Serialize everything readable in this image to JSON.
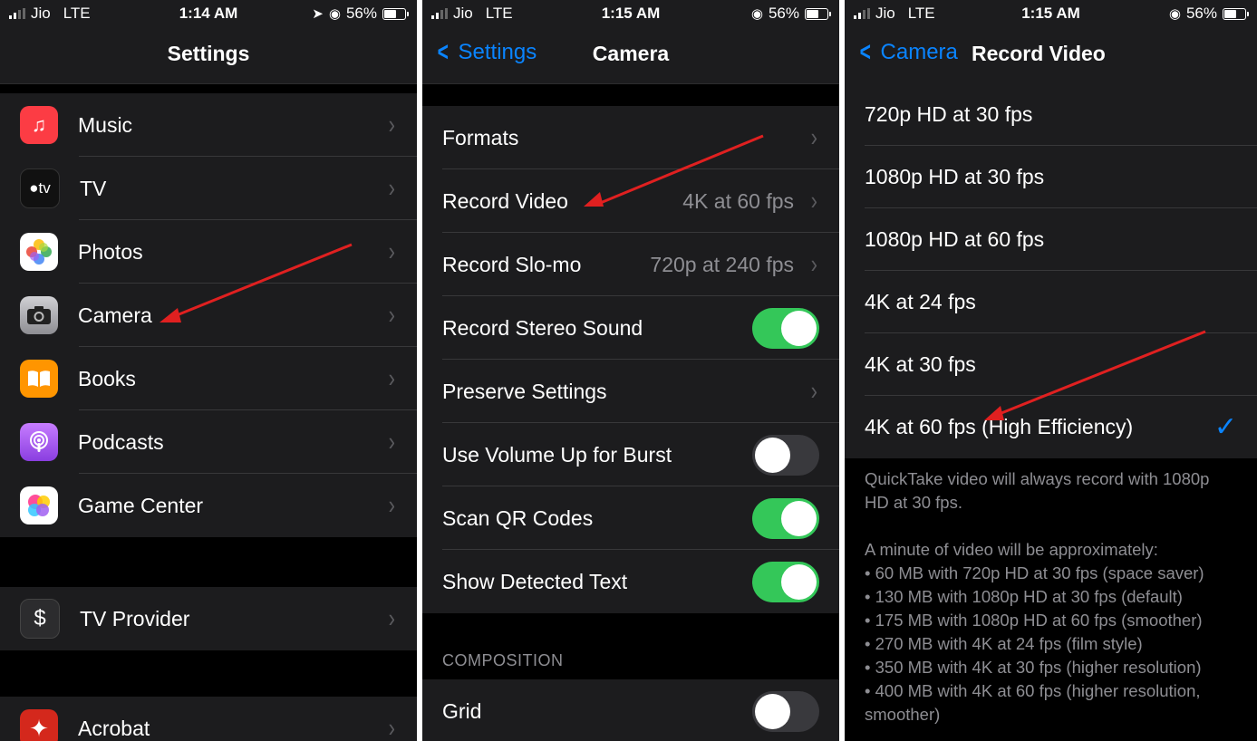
{
  "status_bars": [
    {
      "carrier": "Jio",
      "network": "LTE",
      "time": "1:14 AM",
      "battery": "56%"
    },
    {
      "carrier": "Jio",
      "network": "LTE",
      "time": "1:15 AM",
      "battery": "56%"
    },
    {
      "carrier": "Jio",
      "network": "LTE",
      "time": "1:15 AM",
      "battery": "56%"
    }
  ],
  "battery_level": 0.56,
  "settings": {
    "title": "Settings",
    "items": [
      {
        "label": "Music",
        "icon": "music-icon",
        "color": "#fc3c44"
      },
      {
        "label": "TV",
        "icon": "apple-tv-icon",
        "color": "#1c1c1e"
      },
      {
        "label": "Photos",
        "icon": "photos-icon",
        "color": "#ffffff"
      },
      {
        "label": "Camera",
        "icon": "camera-icon",
        "color": "#8e8e93"
      },
      {
        "label": "Books",
        "icon": "books-icon",
        "color": "#ff9500"
      },
      {
        "label": "Podcasts",
        "icon": "podcasts-icon",
        "color": "#a05ff1"
      },
      {
        "label": "Game Center",
        "icon": "game-center-icon",
        "color": "#ffffff"
      }
    ],
    "tv_provider": {
      "label": "TV Provider",
      "icon": "tv-provider-icon",
      "color": "#2c2c2e"
    },
    "acrobat": {
      "label": "Acrobat",
      "icon": "acrobat-icon",
      "color": "#d4281c"
    }
  },
  "camera": {
    "back": "Settings",
    "title": "Camera",
    "rows": [
      {
        "label": "Formats",
        "value": ""
      },
      {
        "label": "Record Video",
        "value": "4K at 60 fps"
      },
      {
        "label": "Record Slo-mo",
        "value": "720p at 240 fps"
      },
      {
        "label": "Record Stereo Sound",
        "toggle": true
      },
      {
        "label": "Preserve Settings",
        "value": ""
      },
      {
        "label": "Use Volume Up for Burst",
        "toggle": false
      },
      {
        "label": "Scan QR Codes",
        "toggle": true
      },
      {
        "label": "Show Detected Text",
        "toggle": true
      }
    ],
    "composition_header": "COMPOSITION",
    "grid": {
      "label": "Grid",
      "toggle": false
    }
  },
  "record_video": {
    "back": "Camera",
    "title": "Record Video",
    "options": [
      "720p HD at 30 fps",
      "1080p HD at 30 fps",
      "1080p HD at 60 fps",
      "4K at 24 fps",
      "4K at 30 fps",
      "4K at 60 fps (High Efficiency)"
    ],
    "selected_index": 5,
    "footer_note": "QuickTake video will always record with 1080p HD at 30 fps.",
    "size_intro": "A minute of video will be approximately:",
    "sizes": [
      "• 60 MB with 720p HD at 30 fps (space saver)",
      "• 130 MB with 1080p HD at 30 fps (default)",
      "• 175 MB with 1080p HD at 60 fps (smoother)",
      "• 270 MB with 4K at 24 fps (film style)",
      "• 350 MB with 4K at 30 fps (higher resolution)",
      "• 400 MB with 4K at 60 fps (higher resolution, smoother)"
    ]
  },
  "colors": {
    "accent": "#0a84ff",
    "toggle_on": "#34c759",
    "annotation_arrow": "#e02020"
  }
}
